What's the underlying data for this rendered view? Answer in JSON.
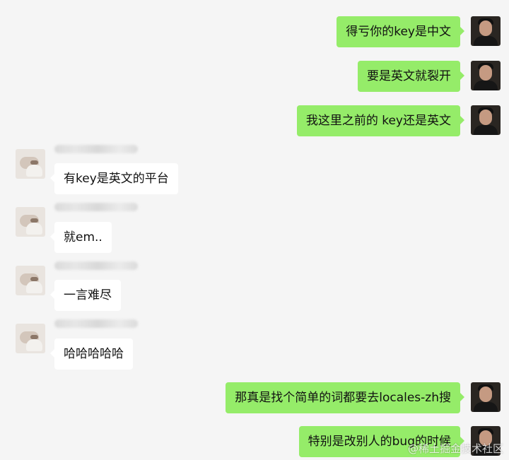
{
  "chat": {
    "messages": [
      {
        "text": "得亏你的key是中文"
      },
      {
        "text": "要是英文就裂开"
      },
      {
        "text": "我这里之前的  key还是英文"
      },
      {
        "text": "有key是英文的平台"
      },
      {
        "text": "就em.."
      },
      {
        "text": "一言难尽"
      },
      {
        "text": "哈哈哈哈哈"
      },
      {
        "text": "那真是找个简单的词都要去locales-zh搜"
      },
      {
        "text": "特别是改别人的bug的时候"
      }
    ],
    "watermark": "@稀土掘金技术社区"
  },
  "colors": {
    "background": "#f5f5f5",
    "self_bubble": "#95ec69",
    "other_bubble": "#ffffff"
  }
}
